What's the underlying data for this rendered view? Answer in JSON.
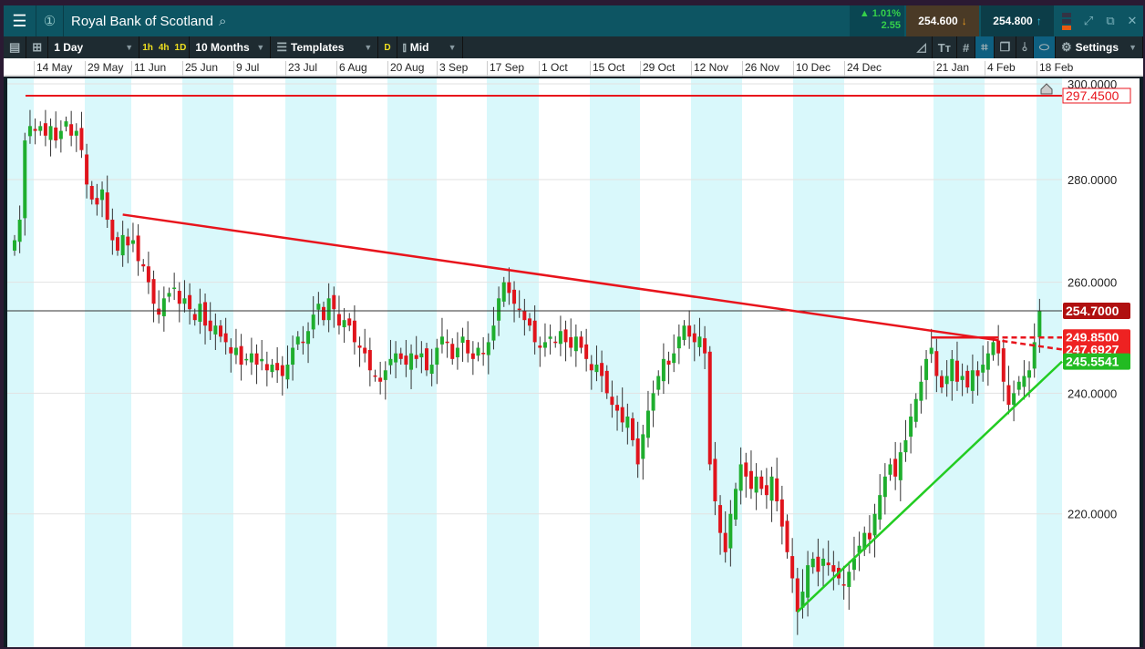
{
  "window": {
    "title": "Royal Bank of Scotland",
    "change_pct": "▲ 1.01%",
    "change_abs": "2.55",
    "sell": "254.600",
    "buy": "254.800"
  },
  "toolbar": {
    "interval": "1 Day",
    "quick": [
      "1h",
      "4h",
      "1D"
    ],
    "range": "10 Months",
    "templates": "Templates",
    "d_label": "D",
    "price_type": "Mid",
    "settings": "Settings"
  },
  "chart_data": {
    "type": "candlestick",
    "title": "Royal Bank of Scotland",
    "x_ticks": [
      "14 May",
      "29 May",
      "11 Jun",
      "25 Jun",
      "9 Jul",
      "23 Jul",
      "6 Aug",
      "20 Aug",
      "3 Sep",
      "17 Sep",
      "1 Oct",
      "15 Oct",
      "29 Oct",
      "12 Nov",
      "26 Nov",
      "10 Dec",
      "24 Dec",
      "21 Jan",
      "4 Feb",
      "18 Feb"
    ],
    "y_ticks": [
      "300.0000",
      "280.0000",
      "260.0000",
      "240.0000",
      "220.0000"
    ],
    "y_tick_values": [
      300,
      280,
      260,
      240,
      220
    ],
    "ylim": [
      203,
      301
    ],
    "y_scale": "log",
    "closes": [
      268,
      272,
      288,
      291,
      290,
      291,
      289,
      291,
      288,
      290,
      292,
      289,
      290,
      286,
      279,
      276,
      275,
      278,
      272,
      268,
      266,
      269,
      267,
      268,
      264,
      263,
      260,
      256,
      254,
      257,
      258,
      259,
      256,
      257,
      255,
      253,
      256,
      252,
      251,
      252,
      250,
      249,
      247,
      248,
      245,
      246,
      247,
      245,
      246,
      244,
      245,
      244,
      243,
      245,
      248,
      250,
      249,
      251,
      254,
      256,
      253,
      257,
      255,
      252,
      253,
      252,
      249,
      248,
      247,
      244,
      243,
      242,
      244,
      246,
      247,
      246,
      245,
      247,
      246,
      247,
      244,
      245,
      248,
      250,
      249,
      246,
      248,
      250,
      247,
      246,
      248,
      247,
      249,
      252,
      257,
      260,
      258,
      256,
      255,
      253,
      252,
      249,
      248,
      249,
      250,
      249,
      251,
      249,
      248,
      250,
      248,
      246,
      244,
      245,
      243,
      240,
      238,
      237,
      235,
      236,
      232,
      228,
      233,
      237,
      240,
      243,
      246,
      245,
      247,
      250,
      252,
      250,
      249,
      250,
      247,
      228,
      222,
      217,
      214,
      220,
      224,
      228,
      226,
      224,
      226,
      224,
      223,
      226,
      222,
      218,
      214,
      210,
      205,
      208,
      212,
      213,
      211,
      213,
      212,
      211,
      210,
      209,
      211,
      213,
      215,
      217,
      216,
      220,
      223,
      226,
      228,
      226,
      230,
      232,
      236,
      239,
      242,
      246,
      248,
      243,
      241,
      243,
      246,
      242,
      243,
      241,
      244,
      243,
      245,
      247,
      249,
      247,
      242,
      238,
      240,
      242,
      243,
      244,
      249,
      254.7
    ],
    "current_price": "254.7000",
    "annotations": [
      {
        "type": "horizontal",
        "label": "297.4500",
        "value": 297.45,
        "color": "#e8141c"
      },
      {
        "type": "trendline",
        "label": "247.6927",
        "from": [
          21,
          273
        ],
        "to_value": 247.6927,
        "color": "#e8141c"
      },
      {
        "type": "horizontal_segment",
        "label": "249.8500",
        "from_index": 178,
        "value": 249.85,
        "color": "#e8141c"
      },
      {
        "type": "trendline",
        "label": "245.5541",
        "from": [
          152,
          205
        ],
        "to_value": 245.5541,
        "color": "#22cc22"
      }
    ],
    "colors": {
      "up": "#1fae2e",
      "down": "#e0141c",
      "band": "#d9f8fb"
    }
  }
}
